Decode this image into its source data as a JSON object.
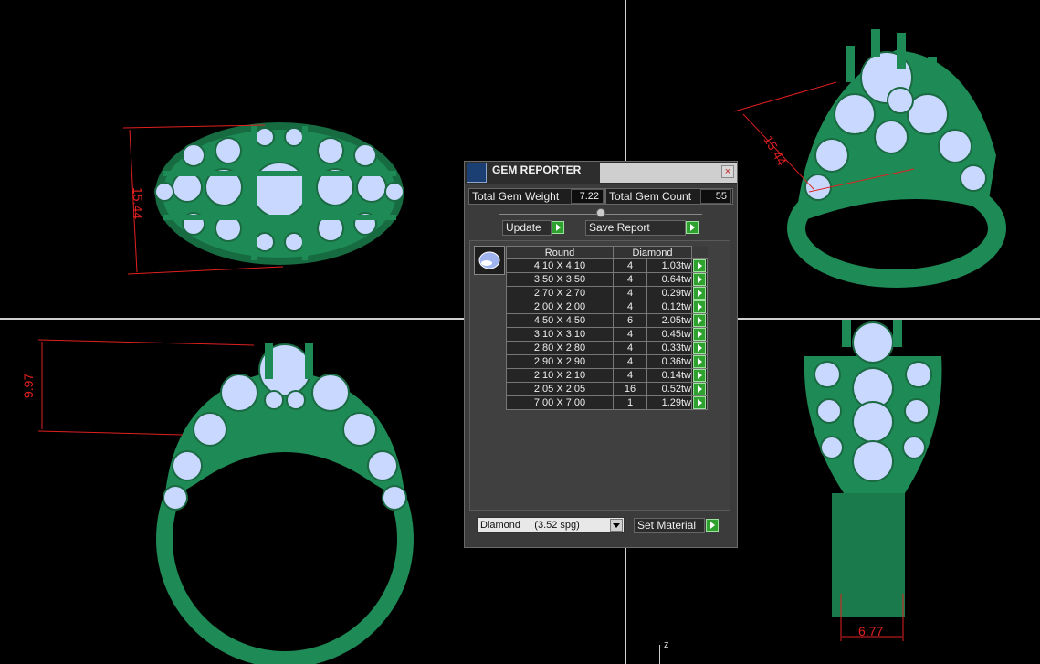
{
  "viewports": {
    "top_left_dim": "15.44",
    "top_right_dim": "15.44",
    "bottom_left_dim": "9.97",
    "bottom_right_dim": "6.77",
    "axis_label": "z"
  },
  "panel": {
    "title": "GEM REPORTER",
    "close_label": "×",
    "total_weight_label": "Total Gem Weight",
    "total_weight_value": "7.22",
    "total_count_label": "Total Gem Count",
    "total_count_value": "55",
    "update_label": "Update",
    "save_report_label": "Save Report",
    "table": {
      "col_shape": "Round",
      "col_material": "Diamond",
      "rows": [
        {
          "size": "4.10 X 4.10",
          "count": "4",
          "weight": "1.03tw"
        },
        {
          "size": "3.50 X 3.50",
          "count": "4",
          "weight": "0.64tw"
        },
        {
          "size": "2.70 X 2.70",
          "count": "4",
          "weight": "0.29tw"
        },
        {
          "size": "2.00 X 2.00",
          "count": "4",
          "weight": "0.12tw"
        },
        {
          "size": "4.50 X 4.50",
          "count": "6",
          "weight": "2.05tw"
        },
        {
          "size": "3.10 X 3.10",
          "count": "4",
          "weight": "0.45tw"
        },
        {
          "size": "2.80 X 2.80",
          "count": "4",
          "weight": "0.33tw"
        },
        {
          "size": "2.90 X 2.90",
          "count": "4",
          "weight": "0.36tw"
        },
        {
          "size": "2.10 X 2.10",
          "count": "4",
          "weight": "0.14tw"
        },
        {
          "size": "2.05 X 2.05",
          "count": "16",
          "weight": "0.52tw"
        },
        {
          "size": "7.00 X 7.00",
          "count": "1",
          "weight": "1.29tw"
        }
      ]
    },
    "material_select": "Diamond     (3.52 spg)",
    "set_material_label": "Set Material"
  },
  "colors": {
    "metal": "#1e8a55",
    "gem": "#c9d8ff",
    "dimension": "#e02020",
    "button_green": "#2fa12f"
  }
}
